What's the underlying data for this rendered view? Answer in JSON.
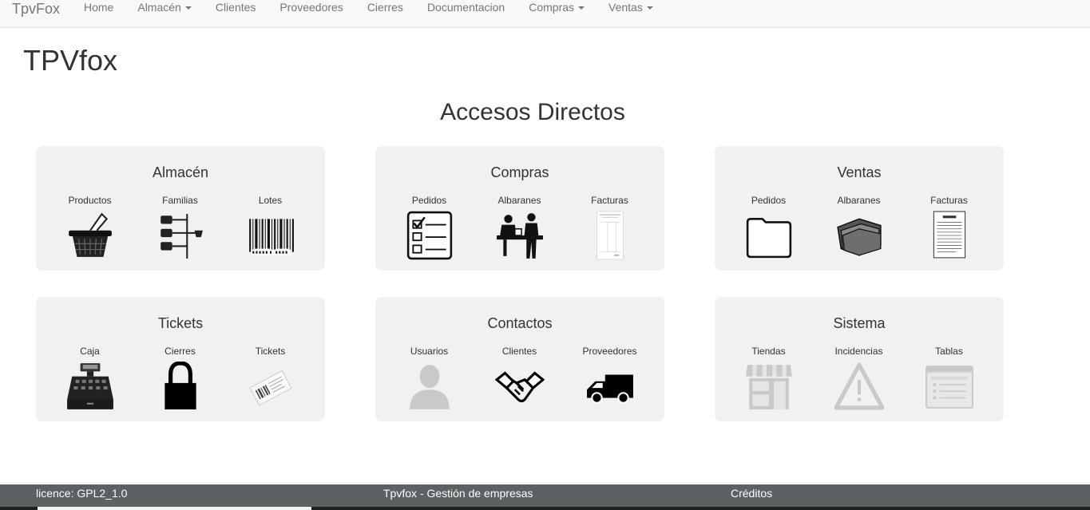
{
  "navbar": {
    "brand": "TpvFox",
    "items": [
      {
        "label": "Home",
        "dropdown": false
      },
      {
        "label": "Almacén",
        "dropdown": true
      },
      {
        "label": "Clientes",
        "dropdown": false
      },
      {
        "label": "Proveedores",
        "dropdown": false
      },
      {
        "label": "Cierres",
        "dropdown": false
      },
      {
        "label": "Documentacion",
        "dropdown": false
      },
      {
        "label": "Compras",
        "dropdown": true
      },
      {
        "label": "Ventas",
        "dropdown": true
      }
    ]
  },
  "page": {
    "title": "TPVfox",
    "section_title": "Accesos Directos"
  },
  "cards": [
    {
      "title": "Almacén",
      "items": [
        {
          "label": "Productos",
          "icon": "shopping-basket-icon"
        },
        {
          "label": "Familias",
          "icon": "family-tree-icon"
        },
        {
          "label": "Lotes",
          "icon": "barcode-icon"
        }
      ]
    },
    {
      "title": "Compras",
      "items": [
        {
          "label": "Pedidos",
          "icon": "checklist-icon"
        },
        {
          "label": "Albaranes",
          "icon": "counter-service-icon"
        },
        {
          "label": "Facturas",
          "icon": "invoice-paper-icon"
        }
      ]
    },
    {
      "title": "Ventas",
      "items": [
        {
          "label": "Pedidos",
          "icon": "folder-outline-icon"
        },
        {
          "label": "Albaranes",
          "icon": "folder-open-icon"
        },
        {
          "label": "Facturas",
          "icon": "invoice-document-icon"
        }
      ]
    },
    {
      "title": "Tickets",
      "items": [
        {
          "label": "Caja",
          "icon": "cash-register-icon"
        },
        {
          "label": "Cierres",
          "icon": "padlock-icon"
        },
        {
          "label": "Tickets",
          "icon": "receipt-ticket-icon"
        }
      ]
    },
    {
      "title": "Contactos",
      "items": [
        {
          "label": "Usuarios",
          "icon": "user-icon"
        },
        {
          "label": "Clientes",
          "icon": "handshake-icon"
        },
        {
          "label": "Proveedores",
          "icon": "delivery-van-icon"
        }
      ]
    },
    {
      "title": "Sistema",
      "items": [
        {
          "label": "Tiendas",
          "icon": "shop-icon"
        },
        {
          "label": "Incidencias",
          "icon": "warning-icon"
        },
        {
          "label": "Tablas",
          "icon": "table-window-icon"
        }
      ]
    }
  ],
  "footer": {
    "licence": "licence: GPL2_1.0",
    "company": "Tpvfox - Gestión de empresas",
    "credits": "Créditos"
  },
  "colors": {
    "navbar_bg": "#f8f8f8",
    "card_bg": "#f1f1f2",
    "footer_bg": "#5a6263",
    "disabled_icon": "#c9c9c9"
  }
}
